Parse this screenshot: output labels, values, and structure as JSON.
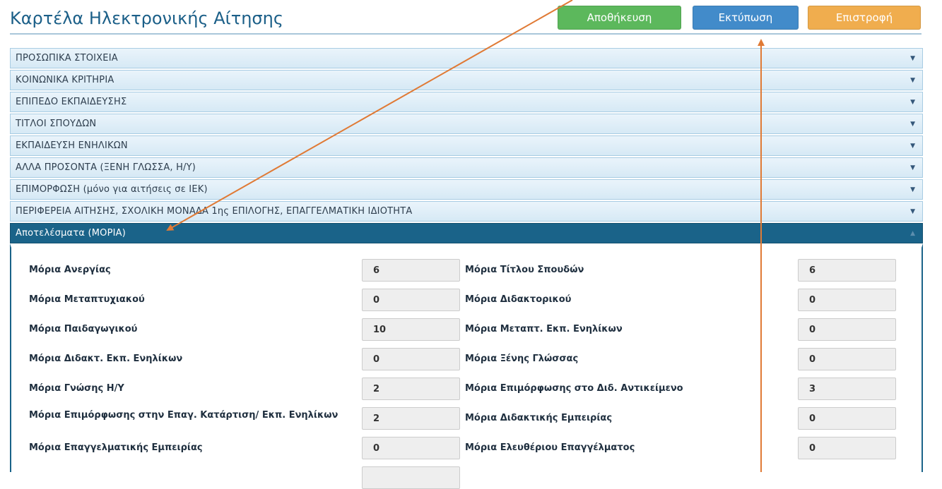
{
  "header": {
    "title": "Καρτέλα Ηλεκτρονικής Αίτησης",
    "save_label": "Αποθήκευση",
    "print_label": "Εκτύπωση",
    "back_label": "Επιστροφή"
  },
  "accordion": [
    {
      "label": "ΠΡΟΣΩΠΙΚΑ ΣΤΟΙΧΕΙΑ"
    },
    {
      "label": "ΚΟΙΝΩΝΙΚΑ ΚΡΙΤΗΡΙΑ"
    },
    {
      "label": "ΕΠΙΠΕΔΟ ΕΚΠΑΙΔΕΥΣΗΣ"
    },
    {
      "label": "ΤΙΤΛΟΙ ΣΠΟΥΔΩΝ"
    },
    {
      "label": "ΕΚΠΑΙΔΕΥΣΗ ΕΝΗΛΙΚΩΝ"
    },
    {
      "label": "ΑΛΛΑ ΠΡΟΣΟΝΤΑ (ΞΕΝΗ ΓΛΩΣΣΑ, Η/Υ)"
    },
    {
      "label": "ΕΠΙΜΟΡΦΩΣΗ (μόνο για αιτήσεις σε ΙΕΚ)"
    },
    {
      "label": "ΠΕΡΙΦΕΡΕΙΑ ΑΙΤΗΣΗΣ, ΣΧΟΛΙΚΗ ΜΟΝΑΔΑ 1ης ΕΠΙΛΟΓΗΣ, ΕΠΑΓΓΕΛΜΑΤΙΚΗ ΙΔΙΟΤΗΤΑ"
    },
    {
      "label": "Αποτελέσματα (ΜΟΡΙΑ)"
    }
  ],
  "results": [
    {
      "left_label": "Μόρια Ανεργίας",
      "left_value": "6",
      "right_label": "Μόρια Τίτλου Σπουδών",
      "right_value": "6"
    },
    {
      "left_label": "Μόρια Μεταπτυχιακού",
      "left_value": "0",
      "right_label": "Μόρια Διδακτορικού",
      "right_value": "0"
    },
    {
      "left_label": "Μόρια Παιδαγωγικού",
      "left_value": "10",
      "right_label": "Μόρια Μεταπτ. Εκπ. Ενηλίκων",
      "right_value": "0"
    },
    {
      "left_label": "Μόρια Διδακτ. Εκπ. Ενηλίκων",
      "left_value": "0",
      "right_label": "Μόρια Ξένης Γλώσσας",
      "right_value": "0"
    },
    {
      "left_label": "Μόρια Γνώσης Η/Υ",
      "left_value": "2",
      "right_label": "Μόρια Επιμόρφωσης στο Διδ. Αντικείμενο",
      "right_value": "3"
    },
    {
      "left_label": "Μόρια Επιμόρφωσης στην Επαγ. Κατάρτιση/ Εκπ. Ενηλίκων",
      "left_value": "2",
      "right_label": "Μόρια Διδακτικής Εμπειρίας",
      "right_value": "0"
    },
    {
      "left_label": "Μόρια Επαγγελματικής Εμπειρίας",
      "left_value": "0",
      "right_label": "Μόρια Ελευθέριου Επαγγέλματος",
      "right_value": "0"
    },
    {
      "left_label": "",
      "left_value": "",
      "right_label": "",
      "right_value": ""
    }
  ],
  "colors": {
    "title": "#1b5f88",
    "save": "#5cb85c",
    "print": "#428bca",
    "back": "#f0ad4e",
    "accordion_active": "#1a6389",
    "annotation_arrow": "#e07a35"
  }
}
